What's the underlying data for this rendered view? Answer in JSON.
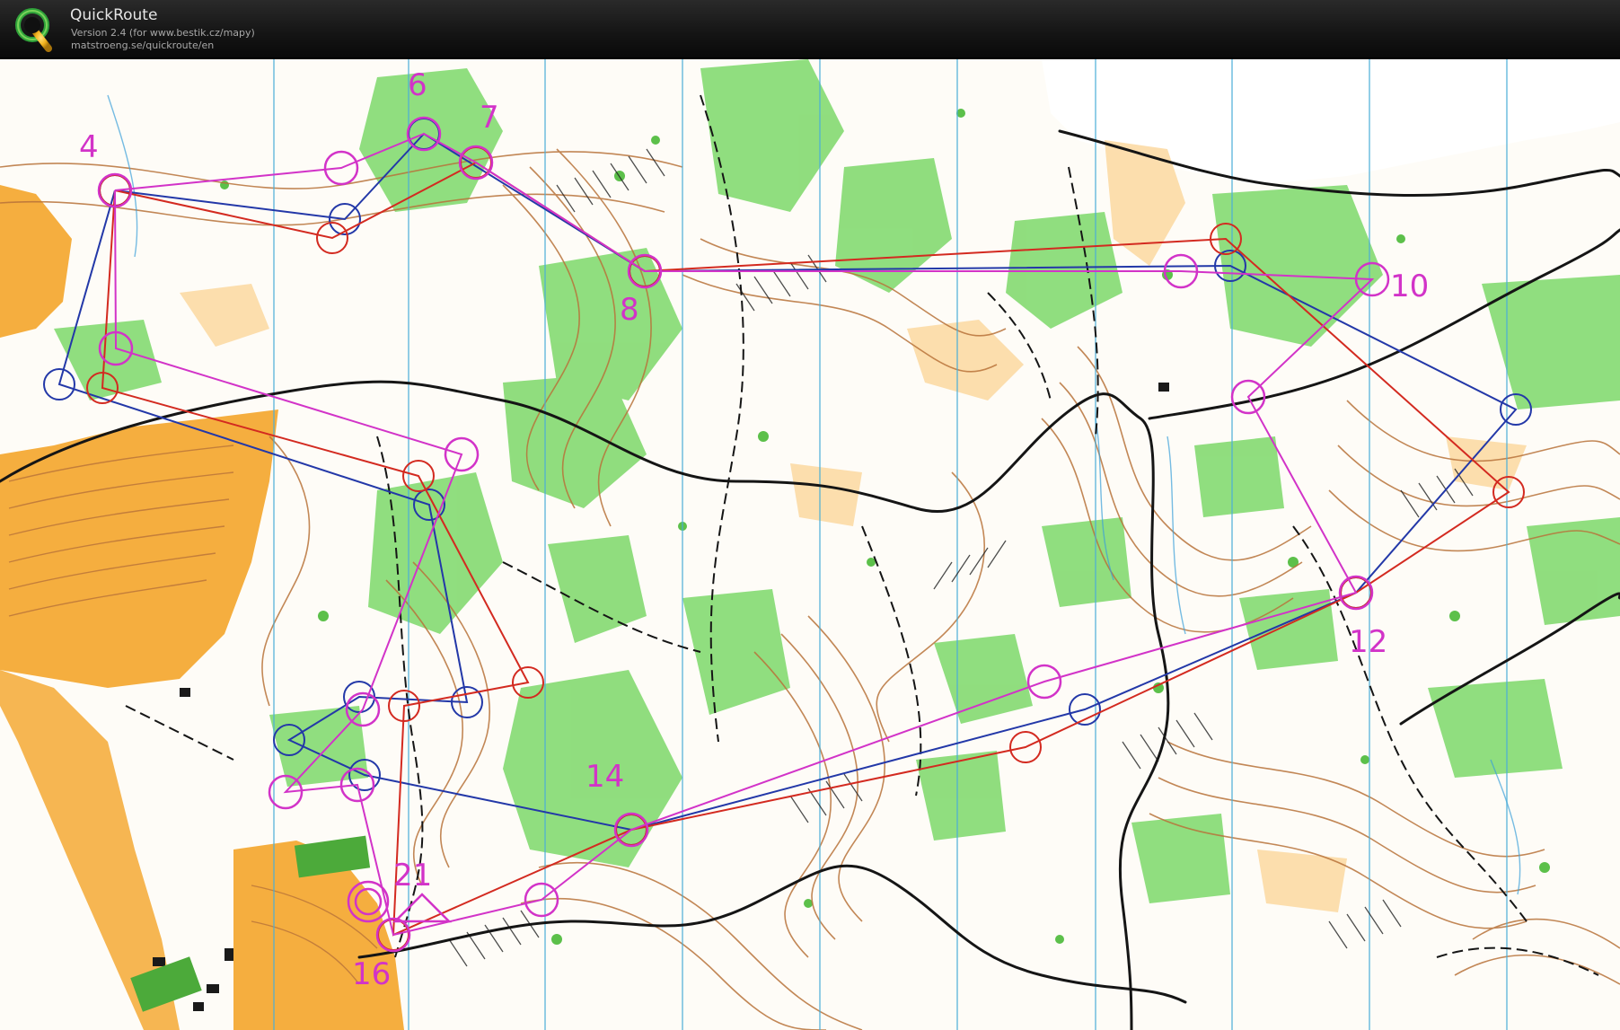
{
  "app": {
    "name": "QuickRoute",
    "version": "Version 2.4  (for www.bestik.cz/mapy)",
    "url": "matstroeng.se/quickroute/en",
    "logo_letter": "Q"
  },
  "colors": {
    "course": "#d233c8",
    "route_blue": "#2338a8",
    "route_red": "#d32a20",
    "forest_green": "#7dd86a",
    "open_yellow": "#f5ae3f",
    "contour_brown": "#b8733a",
    "north_lines": "#4aaed8"
  },
  "map": {
    "control_labels": [
      "4",
      "6",
      "7",
      "8",
      "10",
      "12",
      "14",
      "16",
      "21"
    ]
  }
}
